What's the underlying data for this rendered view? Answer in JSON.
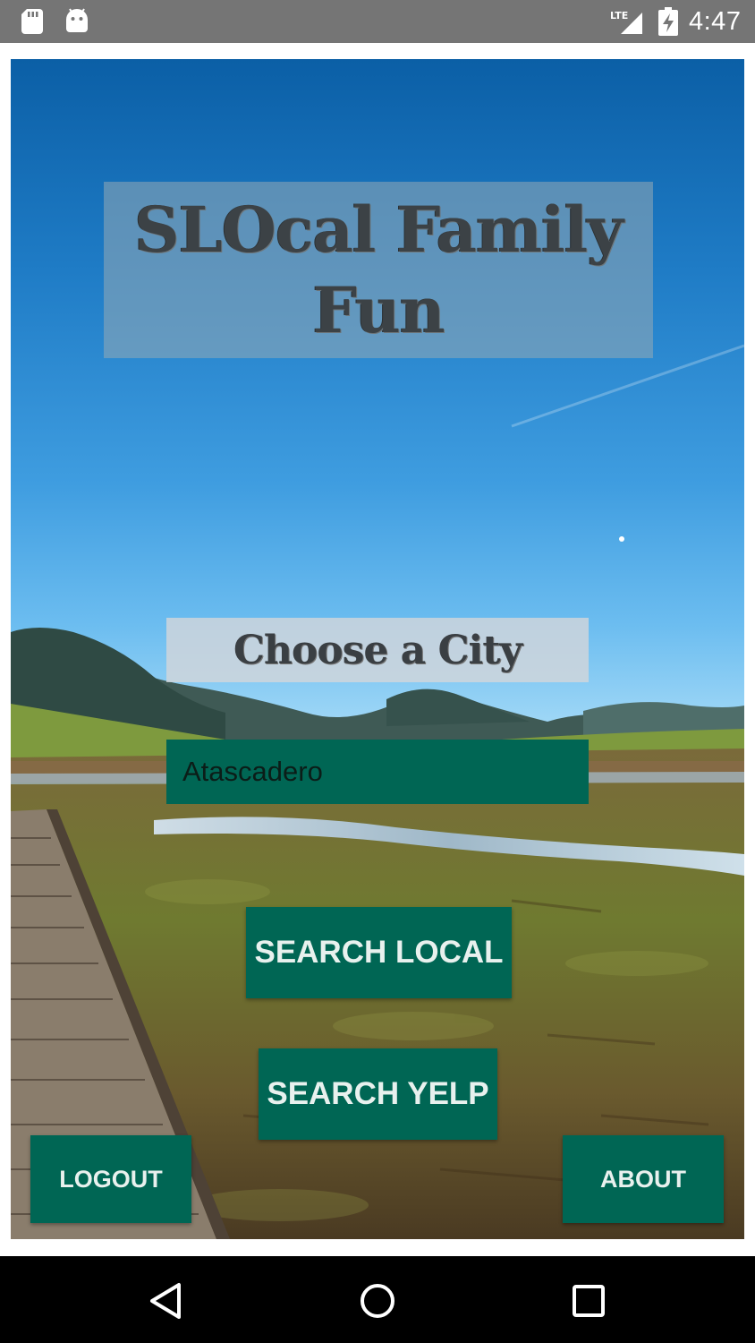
{
  "status_bar": {
    "time": "4:47",
    "network": "LTE",
    "icons": [
      "sd-card-icon",
      "android-icon",
      "lte-signal-icon",
      "battery-charging-icon"
    ]
  },
  "app": {
    "title": "SLOcal Family\nFun",
    "choose_label": "Choose a City",
    "city_select": {
      "value": "Atascadero"
    },
    "buttons": {
      "search_local": "SEARCH LOCAL",
      "search_yelp": "SEARCH YELP",
      "logout": "LOGOUT",
      "about": "ABOUT"
    },
    "colors": {
      "accent": "#006654",
      "title_box": "#96aab4"
    }
  },
  "nav_bar": {
    "icons": [
      "back-icon",
      "home-icon",
      "recent-apps-icon"
    ]
  }
}
